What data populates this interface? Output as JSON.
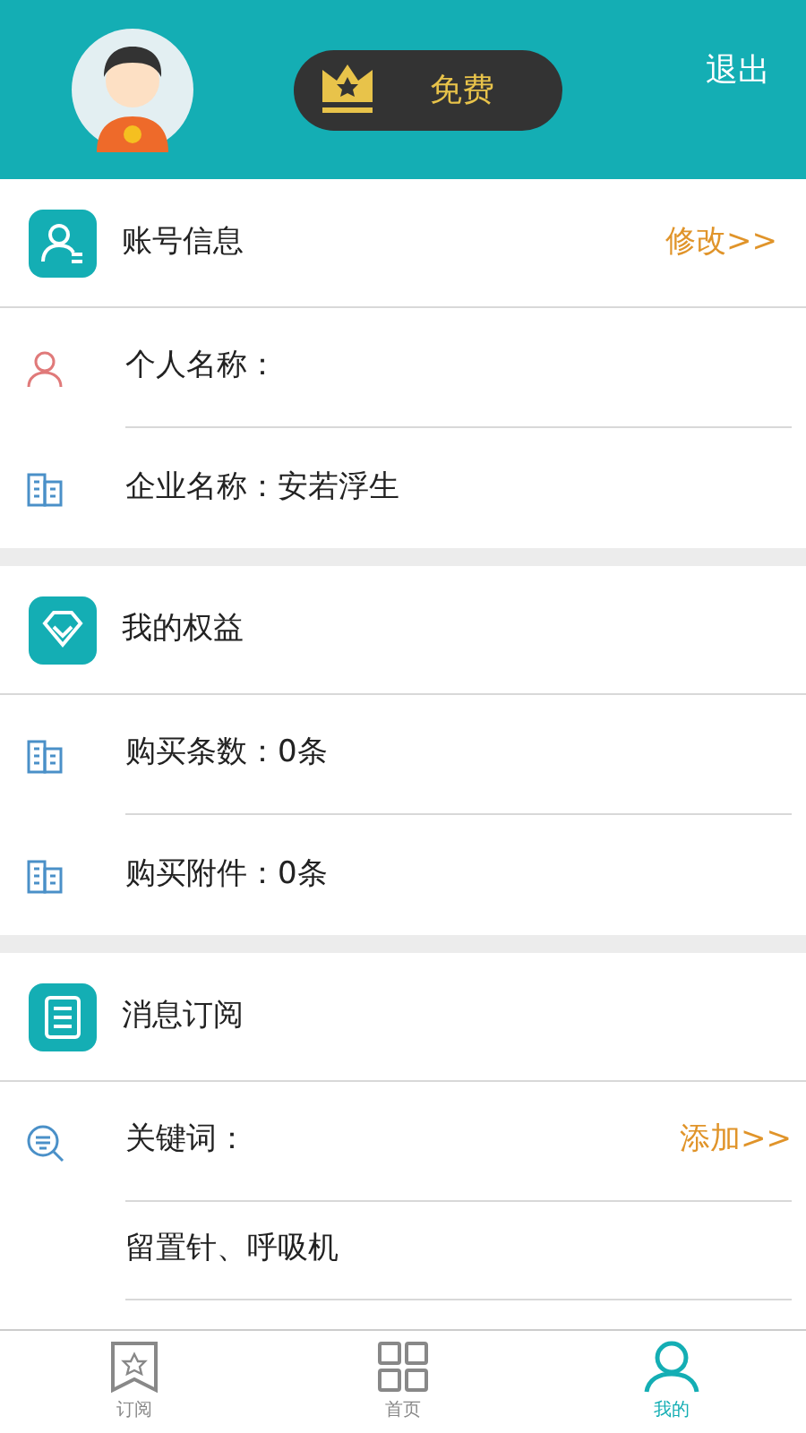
{
  "header": {
    "badge": "免费",
    "logout": "退出"
  },
  "sections": [
    {
      "title": "账号信息",
      "action": "修改>>",
      "rows": [
        {
          "label": "个人名称："
        },
        {
          "label": "企业名称：安若浮生"
        }
      ]
    },
    {
      "title": "我的权益",
      "rows": [
        {
          "label": "购买条数：0条"
        },
        {
          "label": "购买附件：0条"
        }
      ]
    },
    {
      "title": "消息订阅",
      "rows": [
        {
          "label": "关键词：",
          "action": "添加>>"
        },
        {
          "label": "留置针、呼吸机",
          "kind": "value"
        }
      ]
    }
  ],
  "tabs": [
    {
      "label": "订阅",
      "selected": false
    },
    {
      "label": "首页",
      "selected": false
    },
    {
      "label": "我的",
      "selected": true
    }
  ]
}
